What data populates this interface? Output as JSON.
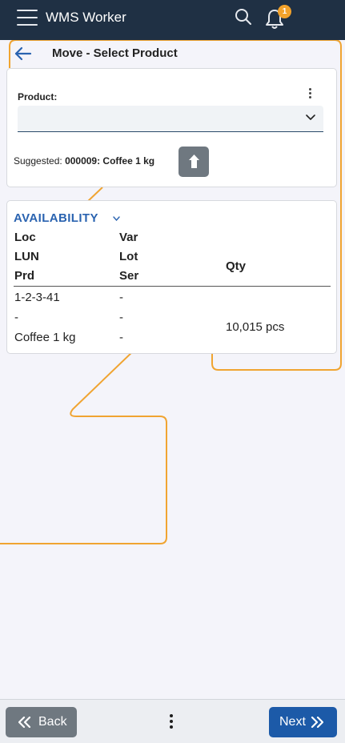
{
  "app": {
    "title": "WMS Worker",
    "notification_count": "1"
  },
  "page": {
    "title": "Move - Select Product"
  },
  "product": {
    "label": "Product:",
    "value": "",
    "suggested_prefix": "Suggested:",
    "suggested_value": "000009: Coffee 1 kg"
  },
  "availability": {
    "title": "AVAILABILITY",
    "headers": {
      "loc": "Loc",
      "lun": "LUN",
      "prd": "Prd",
      "var": "Var",
      "lot": "Lot",
      "ser": "Ser",
      "qty": "Qty"
    },
    "rows": [
      {
        "loc": "1-2-3-41",
        "lun": "-",
        "prd": "Coffee 1 kg",
        "var": "-",
        "lot": "-",
        "ser": "-",
        "qty": "10,015 pcs"
      }
    ]
  },
  "footer": {
    "back_label": "Back",
    "next_label": "Next"
  },
  "colors": {
    "header_bg": "#1f3044",
    "accent": "#2a63b0",
    "primary_button": "#1c5aa8",
    "secondary_button": "#6f7880",
    "badge": "#f2a22b",
    "decoration": "#f0a431"
  },
  "icons": [
    "menu-icon",
    "search-icon",
    "bell-icon",
    "back-arrow-icon",
    "more-vertical-icon",
    "chevron-down-icon",
    "use-suggested-icon",
    "double-chevron-left-icon",
    "double-chevron-right-icon"
  ]
}
